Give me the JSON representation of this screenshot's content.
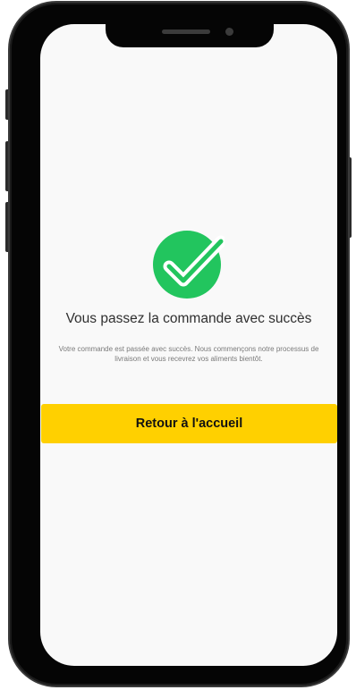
{
  "confirmation": {
    "title": "Vous passez la commande avec succès",
    "message": "Votre commande est passée avec succès. Nous commençons notre processus de livraison et vous recevrez vos aliments bientôt.",
    "icon": "check-circle-icon"
  },
  "actions": {
    "home_label": "Retour à l'accueil"
  },
  "colors": {
    "success": "#22c55e",
    "primary_button": "#ffd000",
    "background": "#f9f9f9"
  }
}
